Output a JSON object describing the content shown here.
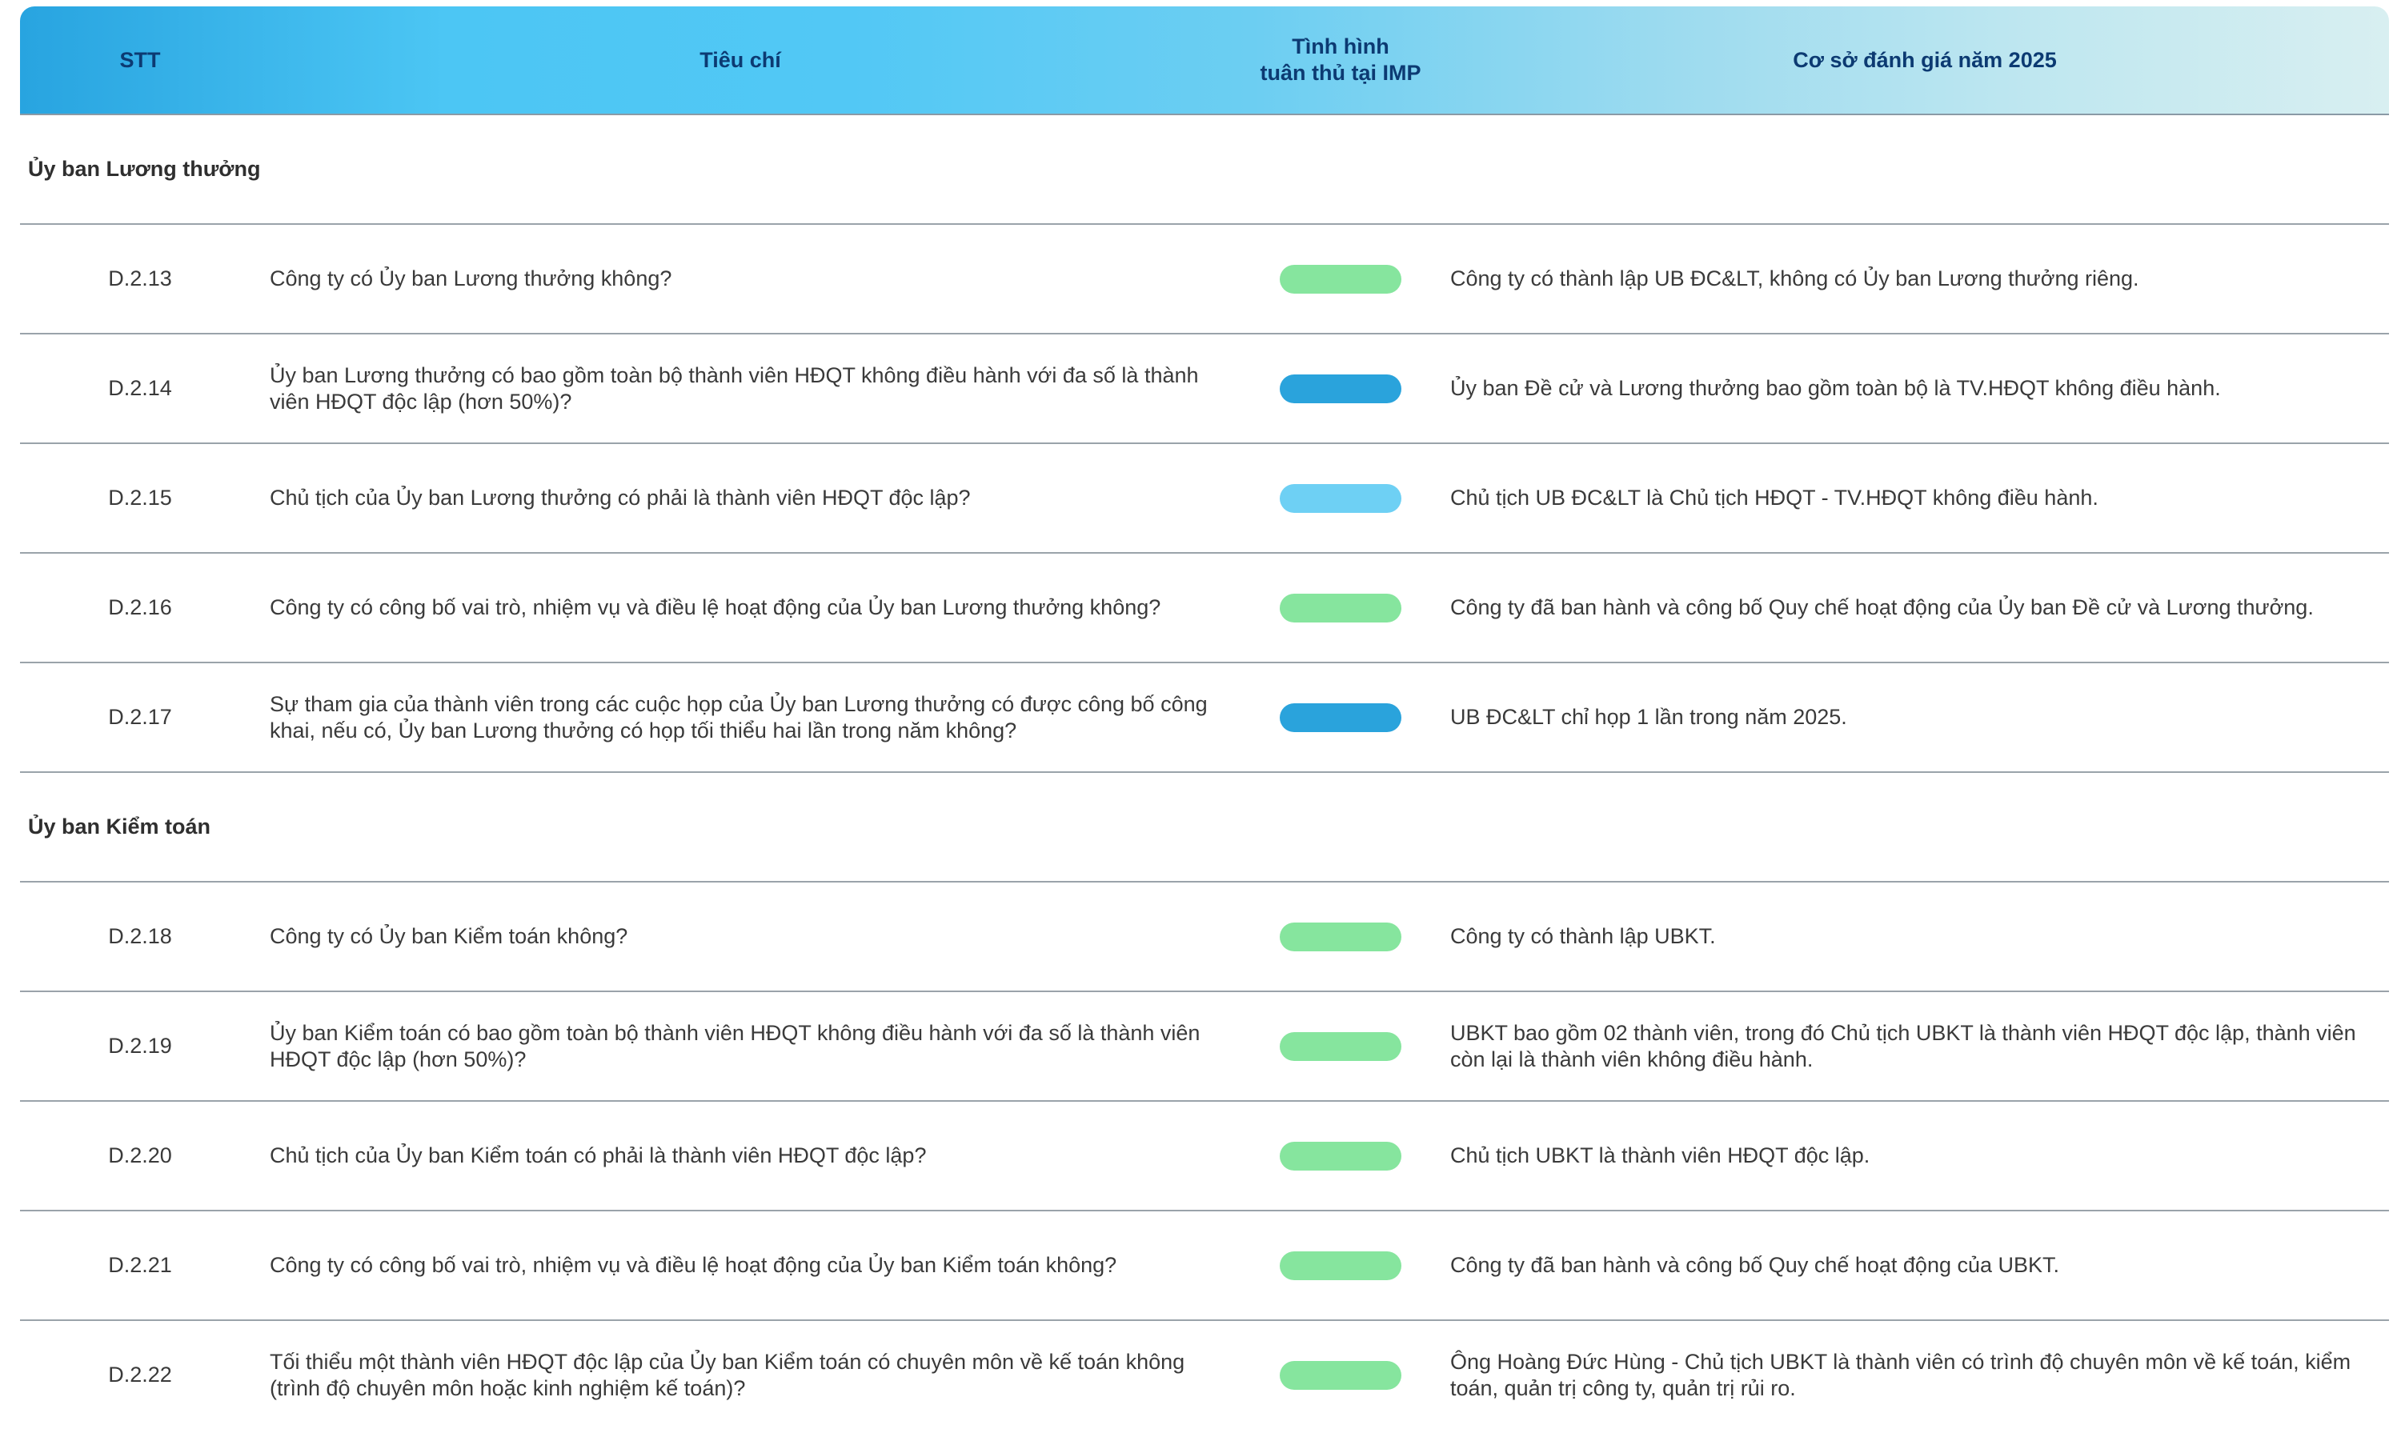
{
  "header": {
    "stt": "STT",
    "tieu_chi": "Tiêu chí",
    "tinh_hinh": "Tình hình\ntuân thủ tại IMP",
    "co_so": "Cơ sở đánh giá năm 2025"
  },
  "status_colors": {
    "green": "#86e59e",
    "dark_blue": "#2aa3dc",
    "light_blue": "#6ed0f4"
  },
  "sections": [
    {
      "title": "Ủy ban Lương thưởng",
      "rows": [
        {
          "stt": "D.2.13",
          "tieu_chi": "Công ty có Ủy ban Lương thưởng không?",
          "status": "green",
          "co_so": "Công ty có thành lập UB ĐC&LT, không có Ủy ban Lương thưởng riêng."
        },
        {
          "stt": "D.2.14",
          "tieu_chi": "Ủy ban Lương thưởng có bao gồm toàn bộ thành viên HĐQT không điều hành với đa số là thành viên HĐQT độc lập (hơn 50%)?",
          "status": "dark_blue",
          "co_so": "Ủy ban Đề cử và Lương thưởng bao gồm toàn bộ là TV.HĐQT không điều hành."
        },
        {
          "stt": "D.2.15",
          "tieu_chi": "Chủ tịch của Ủy ban Lương thưởng có phải là thành viên HĐQT độc lập?",
          "status": "light_blue",
          "co_so": "Chủ tịch UB ĐC&LT là Chủ tịch HĐQT - TV.HĐQT không điều hành."
        },
        {
          "stt": "D.2.16",
          "tieu_chi": "Công ty có công bố vai trò, nhiệm vụ và điều lệ hoạt động của Ủy ban Lương thưởng không?",
          "status": "green",
          "co_so": "Công ty đã ban hành và công bố Quy chế hoạt động của Ủy ban Đề cử và Lương thưởng."
        },
        {
          "stt": "D.2.17",
          "tieu_chi": "Sự tham gia của thành viên trong các cuộc họp của Ủy ban Lương thưởng có được công bố công khai, nếu có, Ủy ban Lương thưởng có họp tối thiểu hai lần trong năm không?",
          "status": "dark_blue",
          "co_so": "UB ĐC&LT chỉ họp 1 lần trong năm 2025."
        }
      ]
    },
    {
      "title": "Ủy ban Kiểm toán",
      "rows": [
        {
          "stt": "D.2.18",
          "tieu_chi": "Công ty có Ủy ban Kiểm toán không?",
          "status": "green",
          "co_so": "Công ty có thành lập UBKT."
        },
        {
          "stt": "D.2.19",
          "tieu_chi": "Ủy ban Kiểm toán có bao gồm toàn bộ thành viên HĐQT không điều hành với đa số là thành viên HĐQT độc lập (hơn 50%)?",
          "status": "green",
          "co_so": "UBKT bao gồm 02 thành viên, trong đó Chủ tịch UBKT là thành viên HĐQT độc lập, thành viên còn lại là thành viên không điều hành."
        },
        {
          "stt": "D.2.20",
          "tieu_chi": "Chủ tịch của Ủy ban Kiểm toán có phải là thành viên HĐQT độc lập?",
          "status": "green",
          "co_so": "Chủ tịch UBKT là thành viên HĐQT độc lập."
        },
        {
          "stt": "D.2.21",
          "tieu_chi": "Công ty có công bố vai trò, nhiệm vụ và điều lệ hoạt động của Ủy ban Kiểm toán không?",
          "status": "green",
          "co_so": "Công ty đã ban hành và công bố Quy chế hoạt động của UBKT."
        },
        {
          "stt": "D.2.22",
          "tieu_chi": "Tối thiểu một thành viên HĐQT độc lập của Ủy ban Kiểm toán có chuyên môn về kế toán không (trình độ chuyên môn hoặc kinh nghiệm kế toán)?",
          "status": "green",
          "co_so": "Ông Hoàng Đức Hùng - Chủ tịch UBKT là thành viên có trình độ chuyên môn về kế toán, kiểm toán, quản trị công ty, quản trị rủi ro."
        }
      ]
    }
  ]
}
